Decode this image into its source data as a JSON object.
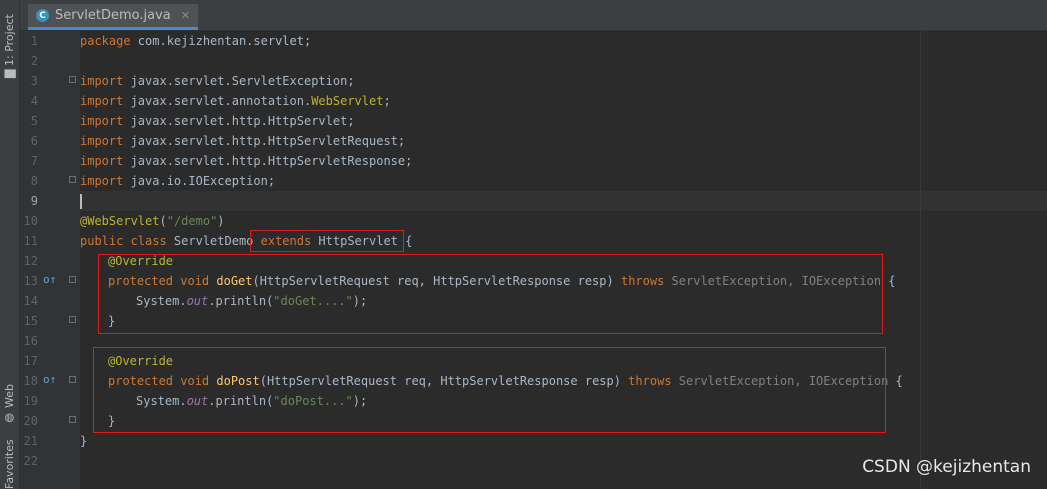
{
  "sidebar": {
    "project_tab": "1: Project",
    "web_tab": "Web",
    "favorites_tab": "Favorites"
  },
  "tab": {
    "filename": "ServletDemo.java",
    "icon_letter": "C",
    "close": "✕"
  },
  "editor": {
    "line_numbers": [
      "1",
      "2",
      "3",
      "4",
      "5",
      "6",
      "7",
      "8",
      "9",
      "10",
      "11",
      "12",
      "13",
      "14",
      "15",
      "16",
      "17",
      "18",
      "19",
      "20",
      "21",
      "22"
    ],
    "line1": {
      "kw": "package",
      "rest": " com.kejizhentan.servlet;"
    },
    "line3": {
      "kw": "import",
      "rest": " javax.servlet.ServletException;"
    },
    "line4": {
      "kw": "import",
      "rest": " javax.servlet.annotation.",
      "ann": "WebServlet",
      "end": ";"
    },
    "line5": {
      "kw": "import",
      "rest": " javax.servlet.http.HttpServlet;"
    },
    "line6": {
      "kw": "import",
      "rest": " javax.servlet.http.HttpServletRequest;"
    },
    "line7": {
      "kw": "import",
      "rest": " javax.servlet.http.HttpServletResponse;"
    },
    "line8": {
      "kw": "import",
      "rest": " java.io.IOException;"
    },
    "line10": {
      "ann": "@WebServlet",
      "open": "(",
      "str": "\"/demo\"",
      "close": ")"
    },
    "line11": {
      "kw1": "public class",
      "name": " ServletDemo ",
      "kw2": "extends",
      "rest": " HttpServlet {"
    },
    "line12": {
      "ann": "@Override"
    },
    "line13": {
      "kw": "protected void ",
      "fn": "doGet",
      "params": "(HttpServletRequest req, HttpServletResponse resp) ",
      "throws": "throws",
      "ex": " ServletException, IOException",
      "brace": " {"
    },
    "line14": {
      "pre": "System.",
      "out": "out",
      "mid": ".println(",
      "str": "\"doGet....\"",
      "end": ");"
    },
    "line15": {
      "text": "}"
    },
    "line17": {
      "ann": "@Override"
    },
    "line18": {
      "kw": "protected void ",
      "fn": "doPost",
      "params": "(HttpServletRequest req, HttpServletResponse resp) ",
      "throws": "throws",
      "ex": " ServletException, IOException",
      "brace": " {"
    },
    "line19": {
      "pre": "System.",
      "out": "out",
      "mid": ".println(",
      "str": "\"doPost...\"",
      "end": ");"
    },
    "line20": {
      "text": "}"
    },
    "line21": {
      "text": "}"
    }
  },
  "watermark": "CSDN @kejizhentan",
  "colors": {
    "background": "#2b2b2b",
    "keyword": "#cc7832",
    "annotation": "#bbb529",
    "string": "#6a8759",
    "method": "#ffc66d",
    "highlight_box": "#e0191b"
  }
}
